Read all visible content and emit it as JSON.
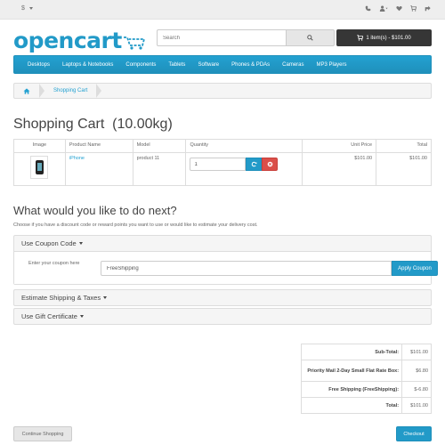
{
  "topbar": {
    "currency": "$"
  },
  "header": {
    "logo": "opencart",
    "search_placeholder": "Search",
    "cart_summary": "1 item(s) - $101.00"
  },
  "menu": [
    "Desktops",
    "Laptops & Notebooks",
    "Components",
    "Tablets",
    "Software",
    "Phones & PDAs",
    "Cameras",
    "MP3 Players"
  ],
  "breadcrumb": {
    "current": "Shopping Cart"
  },
  "page_title": "Shopping Cart  (10.00kg)",
  "cart_table": {
    "headers": {
      "image": "Image",
      "name": "Product Name",
      "model": "Model",
      "quantity": "Quantity",
      "unit_price": "Unit Price",
      "total": "Total"
    },
    "rows": [
      {
        "name": "iPhone",
        "model": "product 11",
        "quantity": "1",
        "unit_price": "$101.00",
        "total": "$101.00"
      }
    ]
  },
  "next": {
    "title": "What would you like to do next?",
    "description": "Choose if you have a discount code or reward points you want to use or would like to estimate your delivery cost."
  },
  "coupon": {
    "heading": "Use Coupon Code",
    "label": "Enter your coupon here",
    "value": "FreeShipping",
    "button": "Apply Coupon"
  },
  "shipping": {
    "heading": "Estimate Shipping & Taxes"
  },
  "gift": {
    "heading": "Use Gift Certificate"
  },
  "totals": [
    {
      "label": "Sub-Total:",
      "value": "$101.00"
    },
    {
      "label": "Priority Mail 2-Day Small Flat Rate Box:",
      "value": "$6.80"
    },
    {
      "label": "Free Shipping (FreeShipping):",
      "value": "$-6.80"
    },
    {
      "label": "Total:",
      "value": "$101.00"
    }
  ],
  "actions": {
    "continue": "Continue Shopping",
    "checkout": "Checkout"
  },
  "colors": {
    "accent": "#229ac8",
    "danger": "#da4f49",
    "dark": "#363636"
  }
}
